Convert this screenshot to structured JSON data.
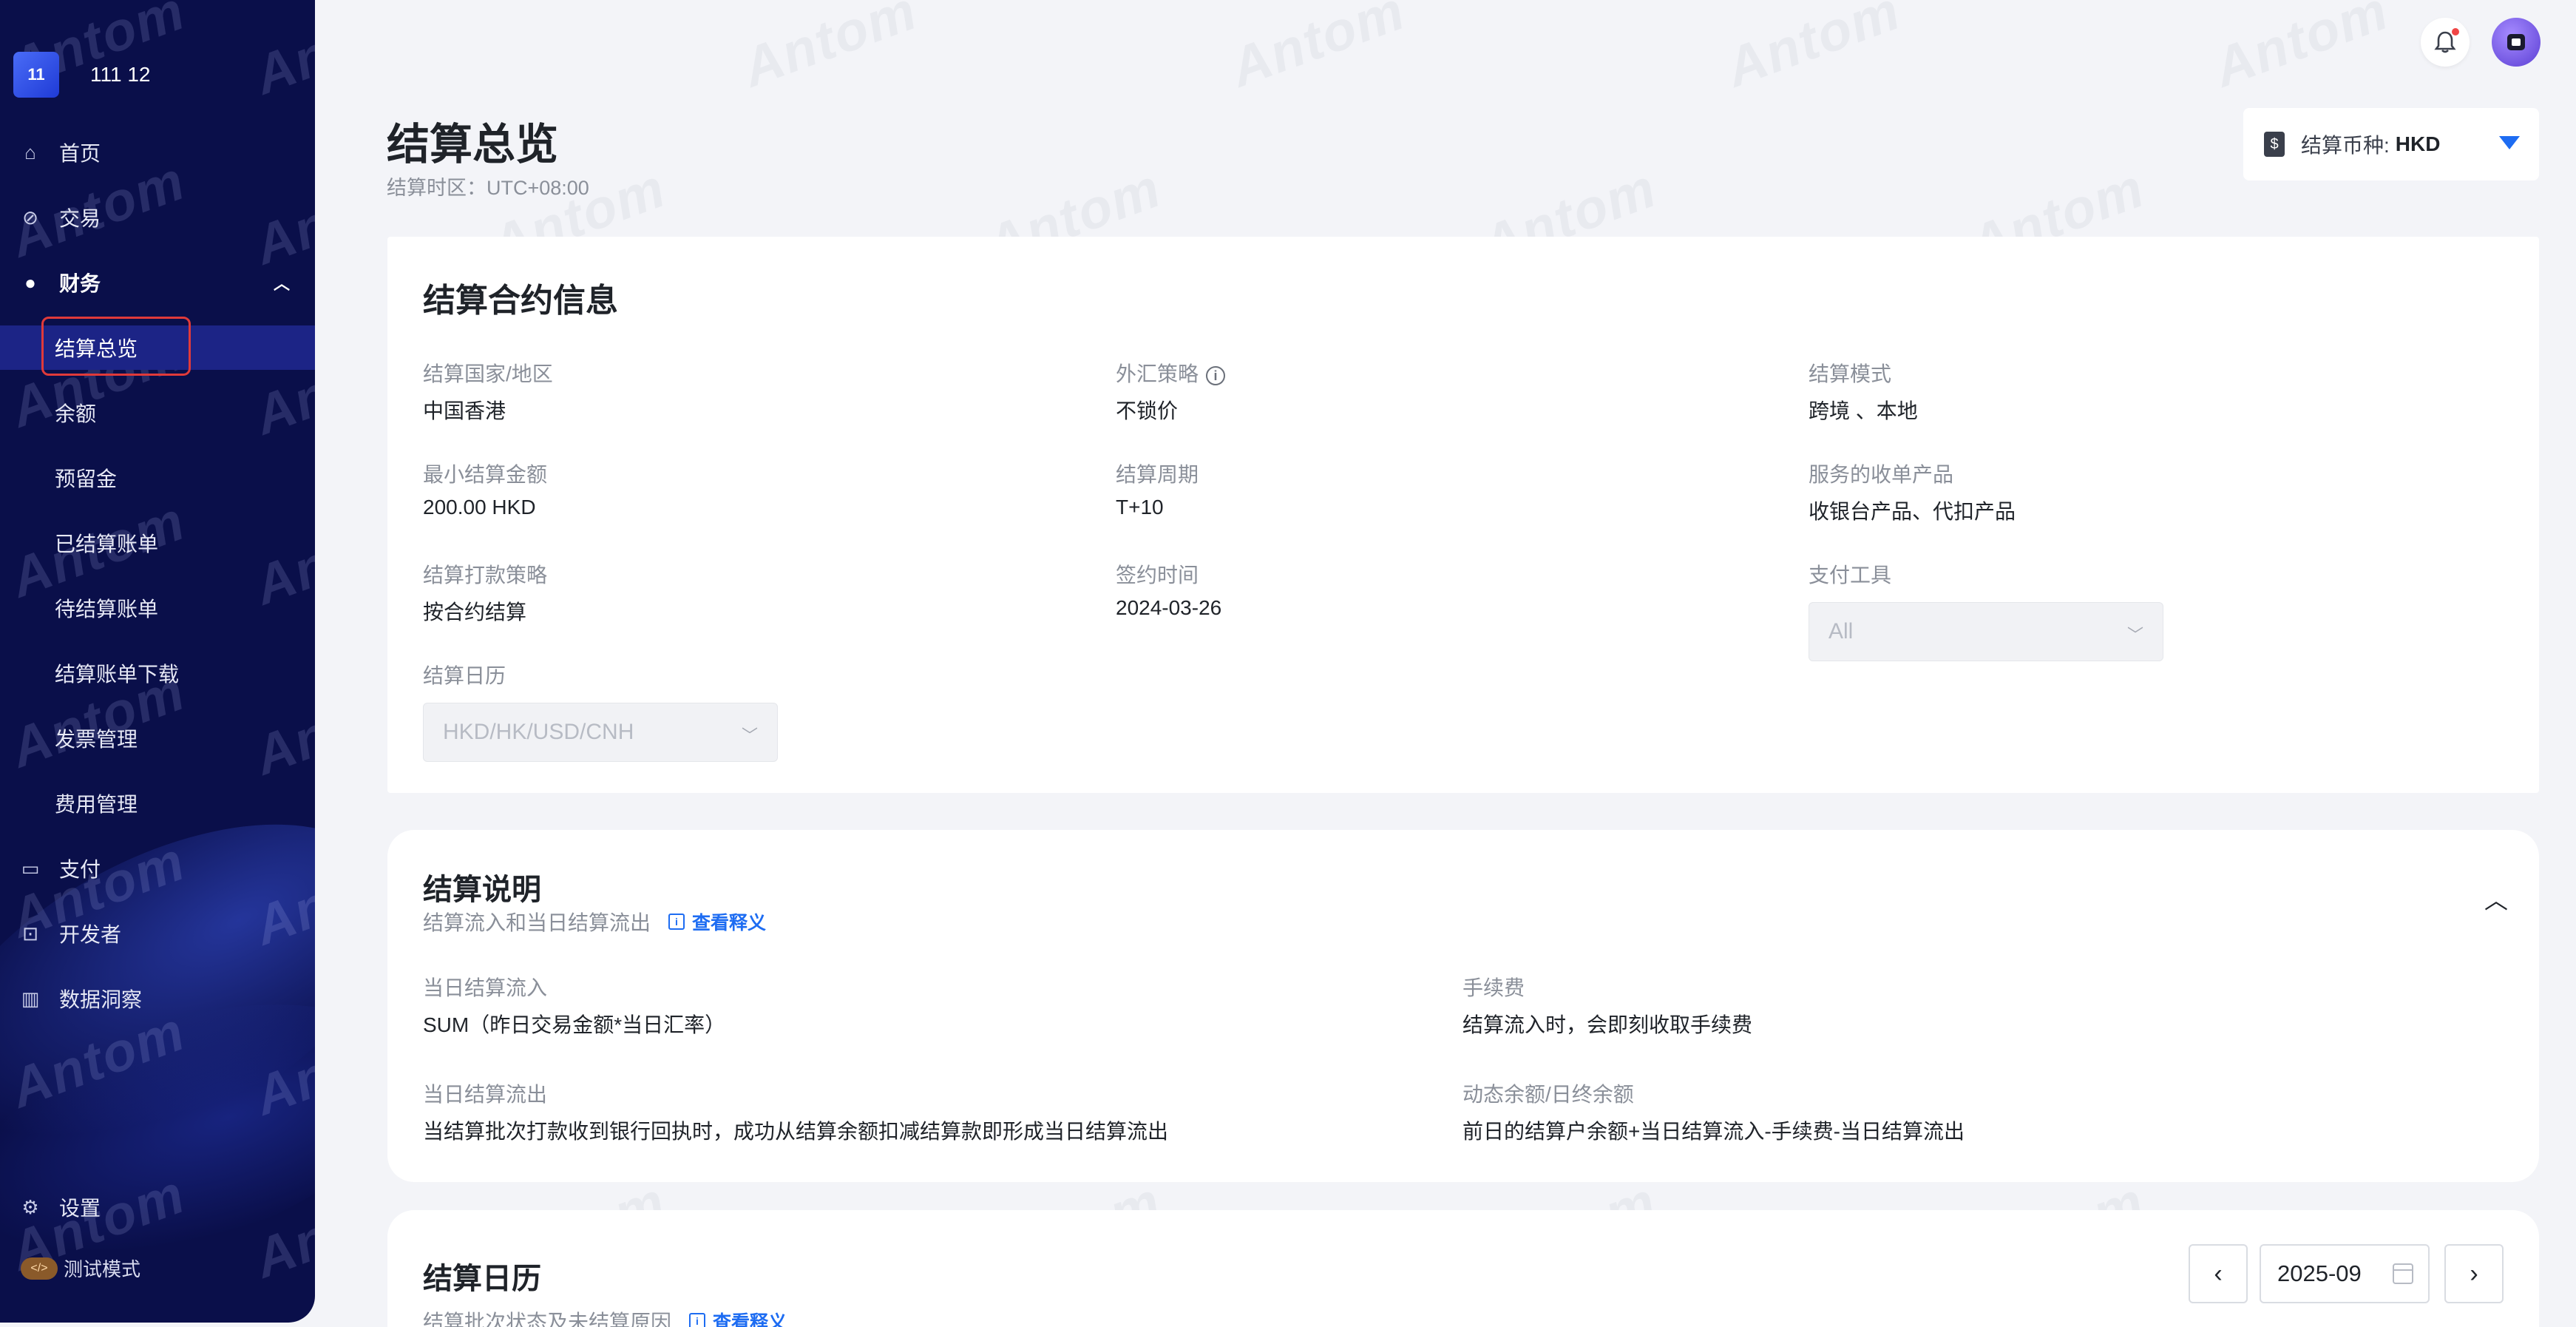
{
  "sidebar": {
    "brand_logo": "11",
    "brand_name": "111 12",
    "items": [
      {
        "label": "首页",
        "icon": "home-icon"
      },
      {
        "label": "交易",
        "icon": "transaction-icon"
      },
      {
        "label": "财务",
        "icon": "finance-icon",
        "expanded": true
      },
      {
        "label": "支付",
        "icon": "payment-icon"
      },
      {
        "label": "开发者",
        "icon": "terminal-icon"
      },
      {
        "label": "数据洞察",
        "icon": "chart-icon"
      }
    ],
    "finance_sub_items": [
      "结算总览",
      "余额",
      "预留金",
      "已结算账单",
      "待结算账单",
      "结算账单下载",
      "发票管理",
      "费用管理"
    ],
    "settings_label": "设置",
    "test_mode_label": "测试模式",
    "test_mode_icon": "</>"
  },
  "watermark_text": "Antom",
  "header": {
    "title": "结算总览",
    "timezone": "结算时区：UTC+08:00",
    "currency_label": "结算币种:",
    "currency_value": "HKD",
    "currency_icon": "$"
  },
  "contract": {
    "title": "结算合约信息",
    "fields": {
      "country": {
        "label": "结算国家/地区",
        "value": "中国香港"
      },
      "fx_strategy": {
        "label": "外汇策略",
        "value": "不锁价"
      },
      "mode": {
        "label": "结算模式",
        "value": "跨境 、本地"
      },
      "min_amount": {
        "label": "最小结算金额",
        "value": "200.00 HKD"
      },
      "cycle": {
        "label": "结算周期",
        "value": "T+10"
      },
      "products": {
        "label": "服务的收单产品",
        "value": "收银台产品、代扣产品"
      },
      "payout_strategy": {
        "label": "结算打款策略",
        "value": "按合约结算"
      },
      "sign_date": {
        "label": "签约时间",
        "value": "2024-03-26"
      },
      "payment_tool": {
        "label": "支付工具",
        "value": "All"
      },
      "calendar": {
        "label": "结算日历",
        "value": "HKD/HK/USD/CNH"
      }
    }
  },
  "explain": {
    "title": "结算说明",
    "subtitle": "结算流入和当日结算流出",
    "link": "查看释义",
    "items": {
      "inflow": {
        "label": "当日结算流入",
        "value": "SUM（昨日交易金额*当日汇率）"
      },
      "fee": {
        "label": "手续费",
        "value": "结算流入时，会即刻收取手续费"
      },
      "outflow": {
        "label": "当日结算流出",
        "value": "当结算批次打款收到银行回执时，成功从结算余额扣减结算款即形成当日结算流出"
      },
      "balance": {
        "label": "动态余额/日终余额",
        "value": "前日的结算户余额+当日结算流入-手续费-当日结算流出"
      }
    }
  },
  "calendar_section": {
    "title": "结算日历",
    "subtitle": "结算批次状态及未结算原因",
    "link": "查看释义",
    "month": "2025-09",
    "prev": "‹",
    "next": "›"
  },
  "colors": {
    "sidebar_bg": "#0a0f4a",
    "accent": "#1d6cf2",
    "active_outline": "#e03a3a"
  }
}
